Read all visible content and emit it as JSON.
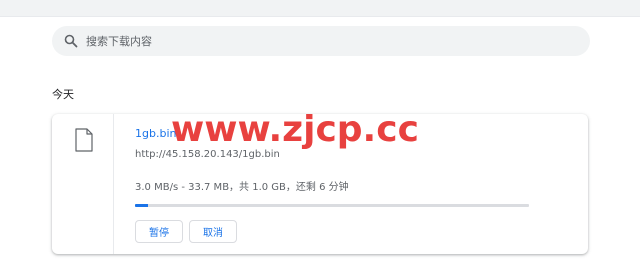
{
  "search": {
    "placeholder": "搜索下载内容"
  },
  "section": {
    "title": "今天"
  },
  "download": {
    "file_name": "1gb.bin",
    "url": "http://45.158.20.143/1gb.bin",
    "status": "3.0 MB/s - 33.7 MB，共 1.0 GB，还剩 6 分钟",
    "progress_fraction": 0.033,
    "pause_label": "暂停",
    "cancel_label": "取消"
  },
  "watermark": {
    "text": "www.zjcp.cc"
  },
  "colors": {
    "accent": "#1a73e8",
    "watermark": "#e8413f",
    "search_bg": "#f1f3f4"
  },
  "icons": {
    "search": "search-icon",
    "file": "file-icon"
  }
}
